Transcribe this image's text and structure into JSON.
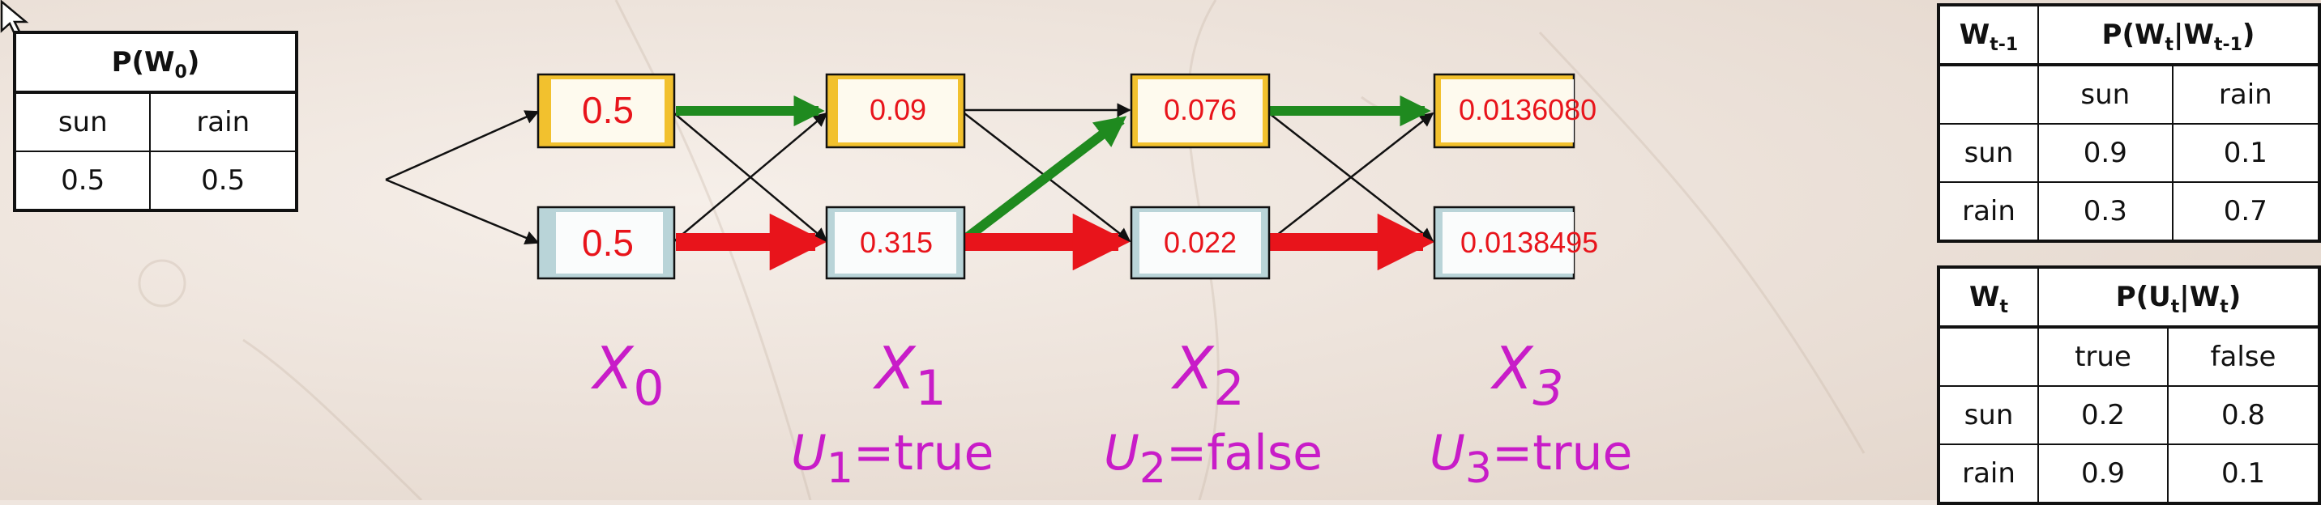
{
  "prior_table": {
    "title_main": "P(W",
    "title_sub": "0",
    "title_close": ")",
    "columns": [
      "sun",
      "rain"
    ],
    "values": [
      "0.5",
      "0.5"
    ]
  },
  "transition_table": {
    "h1_main": "W",
    "h1_sub": "t-1",
    "h2_a": "P(W",
    "h2_sub_a": "t",
    "h2_b": "|W",
    "h2_sub_b": "t-1",
    "h2_c": ")",
    "columns": [
      "sun",
      "rain"
    ],
    "rows": [
      {
        "label": "sun",
        "values": [
          "0.9",
          "0.1"
        ]
      },
      {
        "label": "rain",
        "values": [
          "0.3",
          "0.7"
        ]
      }
    ]
  },
  "emission_table": {
    "h1_main": "W",
    "h1_sub": "t",
    "h2_a": "P(U",
    "h2_sub_a": "t",
    "h2_b": "|W",
    "h2_sub_b": "t",
    "h2_c": ")",
    "columns": [
      "true",
      "false"
    ],
    "rows": [
      {
        "label": "sun",
        "values": [
          "0.2",
          "0.8"
        ]
      },
      {
        "label": "rain",
        "values": [
          "0.9",
          "0.1"
        ]
      }
    ]
  },
  "trellis": {
    "nodes": [
      {
        "id": "s0",
        "label": "0.5",
        "state": "sun"
      },
      {
        "id": "r0",
        "label": "0.5",
        "state": "rain"
      },
      {
        "id": "s1",
        "label": "0.09",
        "state": "sun"
      },
      {
        "id": "r1",
        "label": "0.315",
        "state": "rain"
      },
      {
        "id": "s2",
        "label": "0.076",
        "state": "sun"
      },
      {
        "id": "r2",
        "label": "0.022",
        "state": "rain"
      },
      {
        "id": "s3",
        "label": "0.0136080",
        "state": "sun"
      },
      {
        "id": "r3",
        "label": "0.0138495",
        "state": "rain"
      }
    ],
    "steps": [
      {
        "x": "X",
        "sub": "0",
        "u": "",
        "u_sub": "",
        "u_val": ""
      },
      {
        "x": "X",
        "sub": "1",
        "u": "U",
        "u_sub": "1",
        "u_val": "=true"
      },
      {
        "x": "X",
        "sub": "2",
        "u": "U",
        "u_sub": "2",
        "u_val": "=false"
      },
      {
        "x": "X",
        "sub": "3",
        "u": "U",
        "u_sub": "3",
        "u_val": "=true"
      }
    ]
  },
  "colors": {
    "sun_fill": "#f2c12e",
    "rain_fill": "#b9d4d8",
    "value_text": "#e8141b",
    "label_text": "#c81cc8",
    "best_sun_path": "#1f8a1f",
    "best_rain_path": "#e8141b"
  }
}
